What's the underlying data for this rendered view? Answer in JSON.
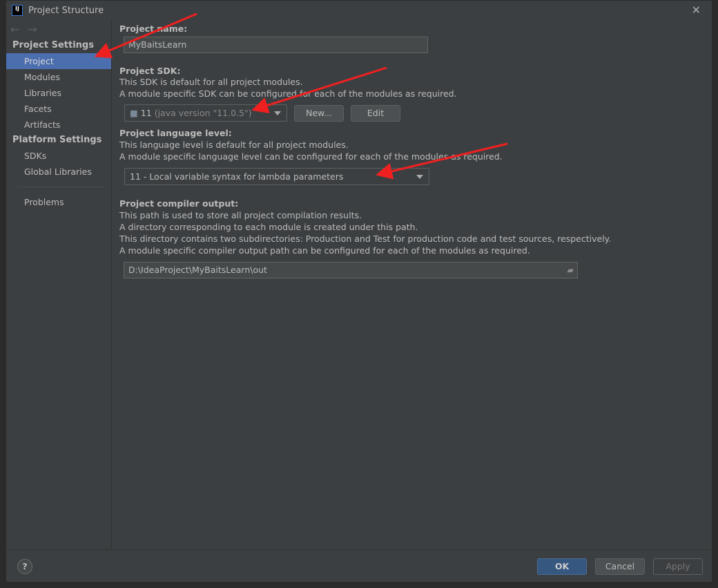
{
  "window": {
    "title": "Project Structure",
    "logo": "IJ"
  },
  "sidebar": {
    "back": "←",
    "forward": "→",
    "project_settings": "Project Settings",
    "project_items": [
      {
        "label": "Project",
        "selected": true
      },
      {
        "label": "Modules"
      },
      {
        "label": "Libraries"
      },
      {
        "label": "Facets"
      },
      {
        "label": "Artifacts"
      }
    ],
    "platform_settings": "Platform Settings",
    "platform_items": [
      {
        "label": "SDKs"
      },
      {
        "label": "Global Libraries"
      }
    ],
    "problems": "Problems"
  },
  "main": {
    "name_label": "Project name:",
    "name_value": "MyBaitsLearn",
    "sdk_label": "Project SDK:",
    "sdk_desc1": "This SDK is default for all project modules.",
    "sdk_desc2": "A module specific SDK can be configured for each of the modules as required.",
    "sdk_value": "11",
    "sdk_version": "(java version \"11.0.5\")",
    "new_button": "New...",
    "edit_button": "Edit",
    "lang_label": "Project language level:",
    "lang_desc1": "This language level is default for all project modules.",
    "lang_desc2": "A module specific language level can be configured for each of the modules as required.",
    "lang_value": "11 - Local variable syntax for lambda parameters",
    "out_label": "Project compiler output:",
    "out_desc1": "This path is used to store all project compilation results.",
    "out_desc2": "A directory corresponding to each module is created under this path.",
    "out_desc3": "This directory contains two subdirectories: Production and Test for production code and test sources, respectively.",
    "out_desc4": "A module specific compiler output path can be configured for each of the modules as required.",
    "out_value": "D:\\IdeaProject\\MyBaitsLearn\\out"
  },
  "footer": {
    "help": "?",
    "ok": "OK",
    "cancel": "Cancel",
    "apply": "Apply"
  },
  "colors": {
    "selection": "#4b6eaf",
    "ok_button": "#365880",
    "annotation_arrow": "#f02020"
  }
}
